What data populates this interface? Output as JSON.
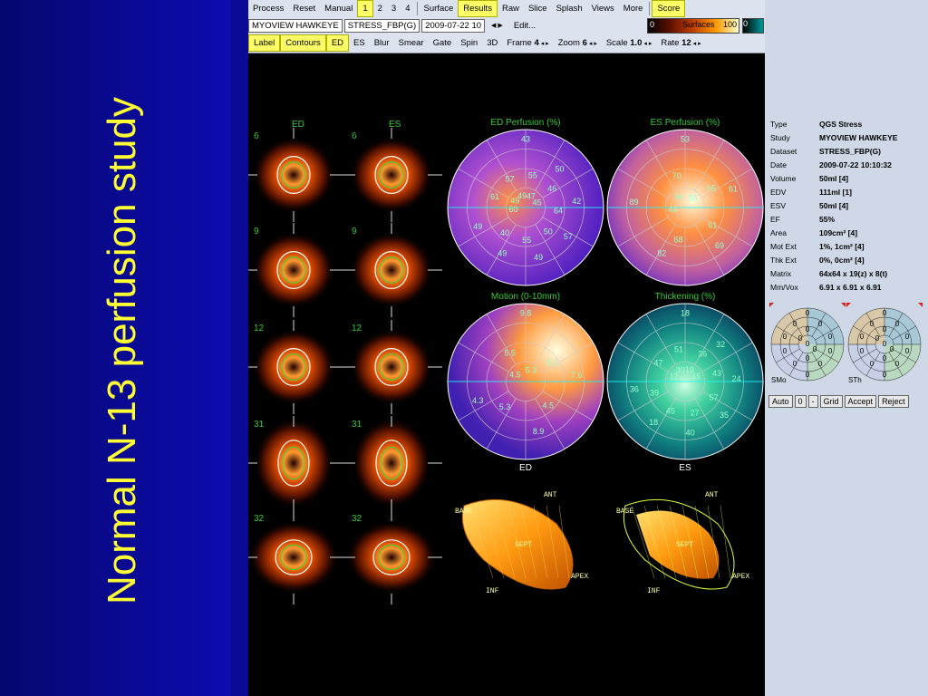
{
  "slide": {
    "title": "Normal N-13 perfusion study"
  },
  "toolbar": {
    "row1": [
      "Process",
      "Reset",
      "Manual",
      "1",
      "2",
      "3",
      "4",
      "Surface",
      "Results",
      "Raw",
      "Slice",
      "Splash",
      "Views",
      "More",
      "Score"
    ],
    "row1_highlight": [
      "1",
      "Results",
      "Score"
    ],
    "study_select": "MYOVIEW HAWKEYE",
    "dataset_select": "STRESS_FBP(G)",
    "date_select": "2009-07-22 10",
    "edit": "Edit...",
    "row3": [
      "Label",
      "Contours",
      "ED",
      "ES",
      "Blur",
      "Smear",
      "Gate",
      "Spin",
      "3D"
    ],
    "row3_highlight": [
      "Label",
      "Contours",
      "ED"
    ],
    "frame_label": "Frame",
    "frame_value": "4",
    "zoom_label": "Zoom",
    "zoom_value": "6",
    "scale_label": "Scale",
    "scale_value": "1.0",
    "rate_label": "Rate",
    "rate_value": "12",
    "colorbar_min": "0",
    "colorbar_name": "Surfaces",
    "colorbar_max": "100",
    "colorbar2_min": "0"
  },
  "slices": {
    "col_labels": [
      "ED",
      "ES"
    ],
    "row_numbers": [
      "6",
      "9",
      "12",
      "31",
      "32"
    ]
  },
  "polar": {
    "ed_perfusion": {
      "title": "ED Perfusion (%)",
      "values": [
        "43",
        "50",
        "42",
        "57",
        "49",
        "49",
        "49",
        "61",
        "57",
        "55",
        "46",
        "64",
        "50",
        "55",
        "40",
        "60",
        "49",
        "49",
        "47",
        "45"
      ]
    },
    "es_perfusion": {
      "title": "ES Perfusion (%)",
      "values": [
        "53",
        "61",
        "69",
        "82",
        "89",
        "70",
        "95",
        "61",
        "68",
        "44",
        "66",
        "55"
      ]
    },
    "motion": {
      "title": "Motion (0-10mm)",
      "values": [
        "9.8",
        "7.6",
        "8.9",
        "4.3",
        "5.5",
        "5.1",
        "4.5",
        "5.3",
        "4.5",
        "5.3"
      ]
    },
    "thickening": {
      "title": "Thickening (%)",
      "values": [
        "18",
        "32",
        "24",
        "35",
        "40",
        "18",
        "36",
        "47",
        "51",
        "36",
        "43",
        "57",
        "27",
        "45",
        "39",
        "12",
        "30",
        "19",
        "16"
      ]
    },
    "bottom_labels": [
      "ED",
      "ES"
    ]
  },
  "surface3d": {
    "labels": [
      "BASE",
      "ANT",
      "SEPT",
      "APEX",
      "INF"
    ]
  },
  "info": [
    {
      "k": "Type",
      "v": "QGS Stress"
    },
    {
      "k": "Study",
      "v": "MYOVIEW HAWKEYE"
    },
    {
      "k": "Dataset",
      "v": "STRESS_FBP(G)"
    },
    {
      "k": "Date",
      "v": "2009-07-22 10:10:32"
    },
    {
      "k": "Volume",
      "v": "50ml [4]"
    },
    {
      "k": "EDV",
      "v": "111ml [1]"
    },
    {
      "k": "ESV",
      "v": "50ml [4]"
    },
    {
      "k": "EF",
      "v": "55%"
    },
    {
      "k": "Area",
      "v": "109cm² [4]"
    },
    {
      "k": "Mot Ext",
      "v": "1%, 1cm² [4]"
    },
    {
      "k": "Thk Ext",
      "v": "0%, 0cm² [4]"
    },
    {
      "k": "Matrix",
      "v": "64x64 x 19(z) x 8(t)"
    },
    {
      "k": "Mm/Vox",
      "v": "6.91 x 6.91 x 6.91"
    }
  ],
  "mini": {
    "left_label": "SMo",
    "right_label": "STh",
    "zero": "0"
  },
  "buttons": [
    "Auto",
    "0",
    "-",
    "Grid",
    "Accept",
    "Reject"
  ]
}
